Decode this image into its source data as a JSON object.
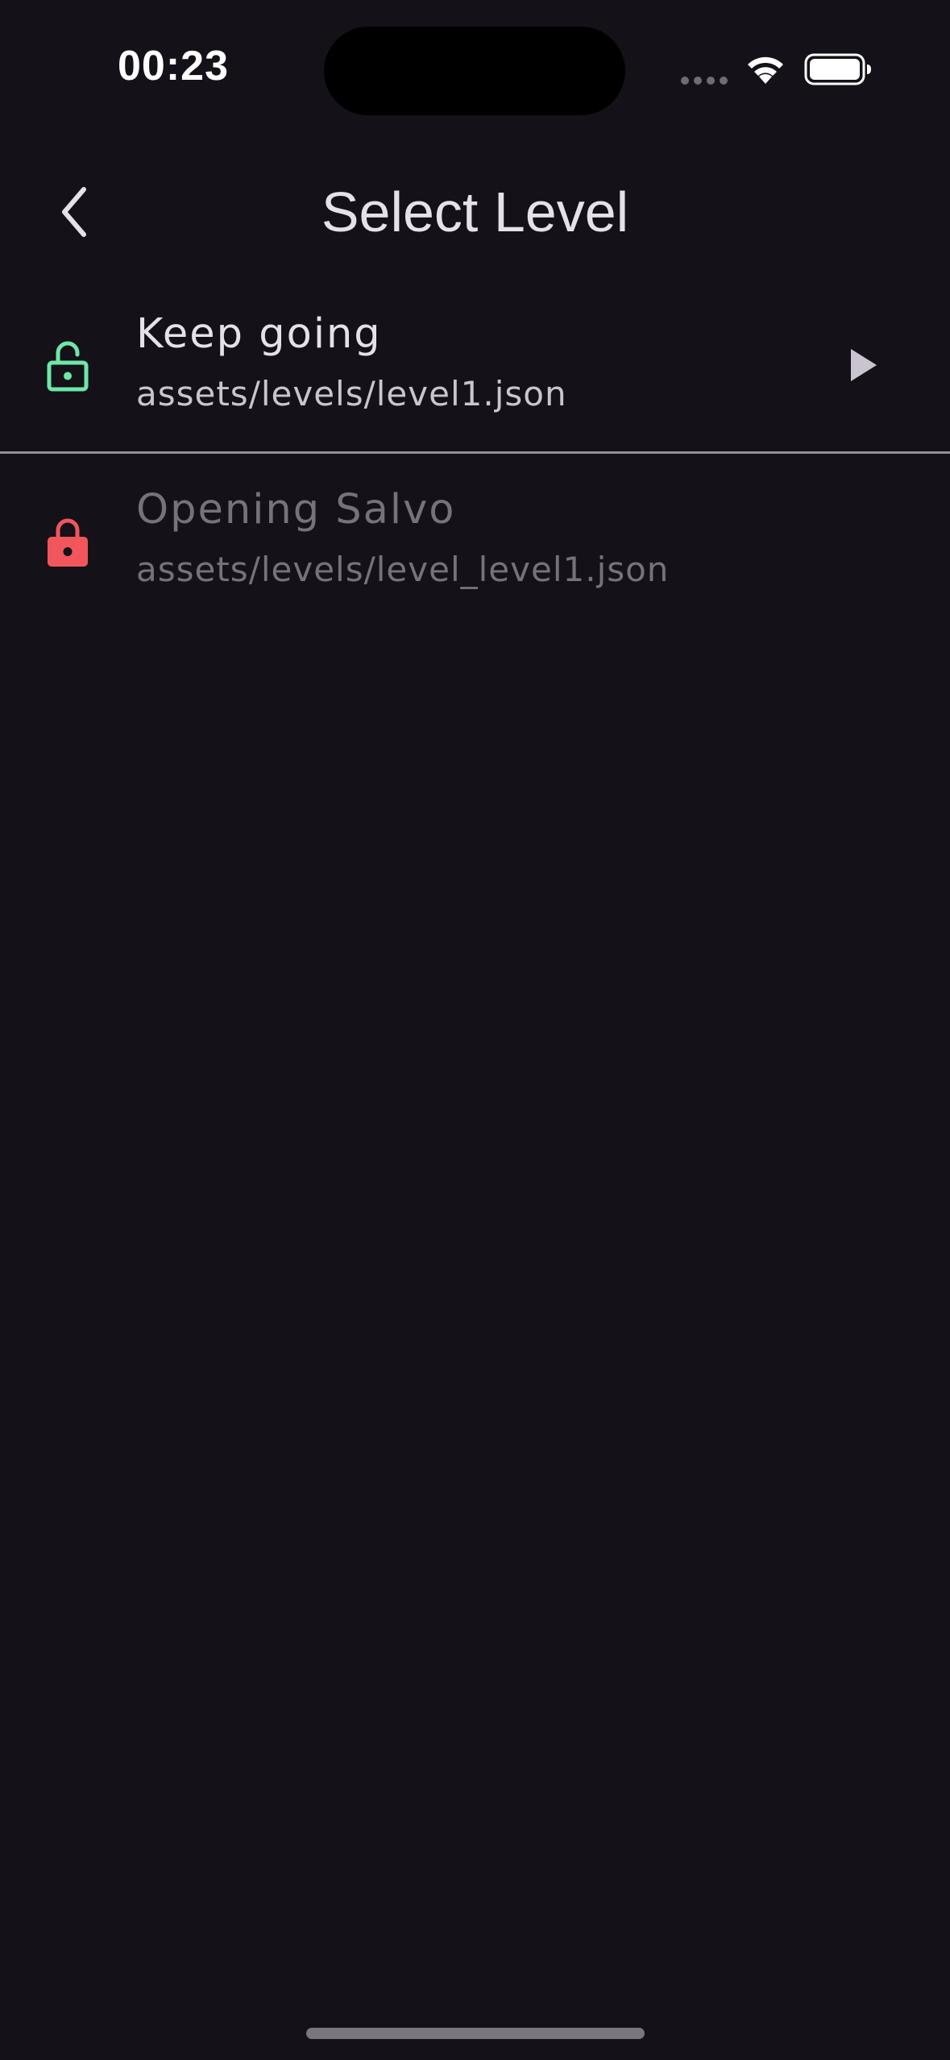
{
  "status_bar": {
    "time": "00:23",
    "icons": [
      "cellular-signal-icon",
      "wifi-icon",
      "battery-icon"
    ]
  },
  "app_bar": {
    "title": "Select Level",
    "back_icon": "chevron-left-icon"
  },
  "levels": [
    {
      "title": "Keep going",
      "path": "assets/levels/level1.json",
      "state": "unlocked",
      "status_icon": "lock-open-icon",
      "status_color": "#6ee7a8",
      "action_icon": "play-icon"
    },
    {
      "title": "Opening Salvo",
      "path": "assets/levels/level_level1.json",
      "state": "locked",
      "status_icon": "lock-icon",
      "status_color": "#f0565c"
    }
  ],
  "colors": {
    "background": "#141218",
    "divider": "#938f99",
    "unlocked": "#6ee7a8",
    "locked": "#f0565c"
  }
}
